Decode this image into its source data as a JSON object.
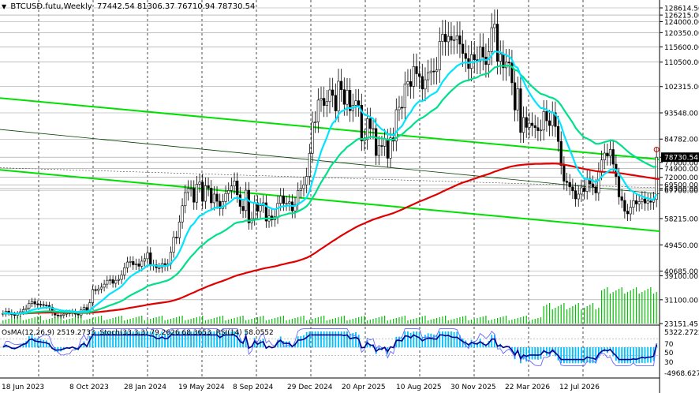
{
  "header": {
    "symbol": "BTCUSD.futu",
    "timeframe": "Weekly",
    "ohlc": "77442.54 81306.37 76710.94 78730.54"
  },
  "indicator_header": {
    "osma": "OsMA(12,26,9) 2519.2733",
    "stoch": "Stoch(33,3,3) 79.2626 68.3653",
    "rsi": "RSI(14) 58.0552"
  },
  "colors": {
    "background": "#ffffff",
    "candle": "#000000",
    "ema_fast": "#00e5ff",
    "ema_mid": "#00e08a",
    "ema_slow": "#e00000",
    "channel": "#00e000",
    "volume": "#00c000",
    "osma": "#00bfff",
    "stoch_main": "#00008b",
    "grid": "#000000"
  },
  "chart_data": {
    "type": "candlestick",
    "price_axis_labels": [
      "128614.50",
      "126215.00",
      "124000.00",
      "120350.00",
      "115600.00",
      "110500.00",
      "102315.00",
      "93548.00",
      "84782.00",
      "78730.54",
      "77000.00",
      "74900.00",
      "72000.00",
      "69500.00",
      "68300.00",
      "67700.00",
      "58215.00",
      "49450.00",
      "40685.00",
      "39100.00",
      "31100.00",
      "23151.45"
    ],
    "price_axis_values": [
      128614.5,
      126215,
      124000,
      120350,
      115600,
      110500,
      102315,
      93548,
      84782,
      78730.54,
      77000,
      74900,
      72000,
      69500,
      68300,
      67700,
      58215,
      49450,
      40685,
      39100,
      31100,
      23151.45
    ],
    "indicator_axis_labels": [
      "5322.2722",
      "70",
      "50",
      "30",
      "-4968.6279"
    ],
    "time_axis_labels": [
      "18 Jun 2023",
      "8 Oct 2023",
      "28 Jan 2024",
      "19 May 2024",
      "8 Sep 2024",
      "29 Dec 2024",
      "20 Apr 2025",
      "10 Aug 2025",
      "30 Nov 2025",
      "22 Mar 2026",
      "12 Jul 2026"
    ],
    "price_range": [
      23151.45,
      128614.5
    ],
    "current_price": 78730.54,
    "close_series": [
      26500,
      27300,
      26800,
      26100,
      25900,
      26300,
      27100,
      27800,
      28300,
      29900,
      30500,
      29700,
      29600,
      29500,
      29300,
      29200,
      28600,
      26800,
      26000,
      25900,
      25900,
      26300,
      26700,
      26500,
      27000,
      26300,
      26000,
      27700,
      28500,
      27200,
      30100,
      34500,
      34200,
      34700,
      35300,
      36300,
      37600,
      37800,
      36600,
      37600,
      37900,
      39400,
      41800,
      43700,
      43900,
      42800,
      43100,
      42300,
      44000,
      44800,
      46800,
      42600,
      42800,
      41800,
      41800,
      43200,
      42400,
      43000,
      47000,
      52000,
      51800,
      57100,
      62500,
      66900,
      68300,
      68300,
      63700,
      69700,
      70400,
      64000,
      69200,
      68400,
      63500,
      66400,
      64000,
      61600,
      63900,
      66600,
      67600,
      69100,
      70800,
      66200,
      62300,
      60900,
      67700,
      56800,
      58200,
      63500,
      60700,
      62600,
      63500,
      57400,
      59100,
      57800,
      58800,
      63300,
      65800,
      63300,
      63300,
      63800,
      60800,
      62900,
      67600,
      68300,
      69500,
      72300,
      80000,
      90400,
      90500,
      97800,
      98400,
      96000,
      97300,
      101200,
      99400,
      94200,
      104100,
      101300,
      96400,
      101100,
      94300,
      96100,
      97600,
      96100,
      84200,
      84600,
      91600,
      88300,
      88300,
      79300,
      82600,
      82400,
      84800,
      78400,
      85200,
      84100,
      94600,
      95400,
      95200,
      103200,
      104000,
      102400,
      109000,
      106600,
      105700,
      101500,
      104600,
      107000,
      107500,
      107300,
      107900,
      117400,
      119800,
      117300,
      119100,
      117800,
      118000,
      119300,
      116500,
      113400,
      111700,
      108400,
      113000,
      111300,
      110900,
      115500,
      112200,
      109700,
      114000,
      122000,
      123200,
      110800,
      113200,
      108600,
      110500,
      110200,
      103600,
      94500,
      101600,
      87000,
      92000,
      88700,
      90100,
      89300,
      88600,
      87600,
      87800,
      94000,
      90900,
      89300,
      93600,
      89000,
      84000,
      76000,
      70700,
      70300,
      68800,
      67500,
      64800,
      66400,
      68500,
      67300,
      71500,
      69800,
      68800,
      66800,
      74000,
      77800,
      80100,
      79100,
      81300,
      76400,
      72300,
      65500,
      64300,
      60700,
      59800,
      62000,
      64200,
      63100,
      63900,
      64800,
      63400,
      64100,
      63700,
      64600,
      78730.54
    ],
    "ema_fast_series": [
      26500,
      26600,
      26635,
      26550,
      26460,
      26440,
      26530,
      26700,
      26900,
      27290,
      27680,
      27920,
      28120,
      28280,
      28410,
      28510,
      28520,
      28310,
      28030,
      27790,
      27580,
      27450,
      27390,
      27300,
      27260,
      27150,
      27010,
      27090,
      27260,
      27240,
      27560,
      28420,
      29150,
      29880,
      30620,
      31430,
      32300,
      33090,
      33640,
      34280,
      34860,
      35620,
      36650,
      37810,
      38820,
      39480,
      40110,
      40540,
      41150,
      41770,
      42660,
      42630,
      42650,
      42480,
      42340,
      42460,
      42420,
      42480,
      43120,
      44360,
      45410,
      47180,
      49310,
      51830,
      53910,
      55700,
      56570,
      57950,
      59180,
      59460,
      60240,
      60810,
      61130,
      61690,
      61960,
      61940,
      62200,
      62730,
      63380,
      64130,
      65010,
      65150,
      64860,
      64400,
      64920,
      64160,
      63590,
      63560,
      63150,
      63000,
      62990,
      62350,
      61960,
      61530,
      61300,
      61610,
      62140,
      62310,
      62450,
      62650,
      62470,
      62500,
      63030,
      63600,
      64300,
      65290,
      67380,
      70750,
      73740,
      77410,
      80660,
      83090,
      85370,
      88100,
      90080,
      91010,
      92980,
      94060,
      94410,
      95250,
      95110,
      95260,
      95640,
      95710,
      94130,
      92910,
      92710,
      92130,
      91630,
      89990,
      88960,
      88020,
      87550,
      86340,
      86300,
      86050,
      87200,
      88270,
      89160,
      90940,
      92610,
      93770,
      95480,
      96620,
      97440,
      97480,
      98040,
      98800,
      99500,
      100040,
      100590,
      102190,
      103900,
      105120,
      106440,
      107420,
      108270,
      109230,
      109770,
      110220,
      110430,
      110200,
      110520,
      110600,
      110650,
      111260,
      111370,
      111150,
      111500,
      112790,
      114050,
      113940,
      113840,
      113220,
      112810,
      112440,
      111350,
      109130,
      108610,
      106050,
      104180,
      102000,
      100320,
      98750,
      97380,
      96140,
      95120,
      95070,
      94540,
      93870,
      93820,
      93020,
      91670,
      89300,
      86180,
      83660,
      81210,
      78840,
      76220,
      74310,
      72870,
      71550,
      71510,
      71270,
      70930,
      70360,
      71140,
      72130,
      73150,
      73750,
      74550,
      74790,
      74500,
      73140,
      71820,
      70230,
      68710,
      67760,
      67160,
      66500,
      66010,
      65700,
      65250,
      64980,
      64700,
      64560,
      66400
    ],
    "ema_mid_series": [
      26500,
      26530,
      26540,
      26520,
      26490,
      26480,
      26510,
      26560,
      26620,
      26750,
      26890,
      26980,
      27060,
      27140,
      27200,
      27250,
      27280,
      27240,
      27170,
      27100,
      27040,
      26990,
      26960,
      26920,
      26900,
      26860,
      26800,
      26800,
      26850,
      26850,
      26950,
      27250,
      27530,
      27820,
      28130,
      28480,
      28870,
      29250,
      29570,
      29930,
      30280,
      30710,
      31280,
      31920,
      32540,
      33050,
      33550,
      33990,
      34510,
      35040,
      35680,
      35980,
      36280,
      36510,
      36730,
      37040,
      37300,
      37580,
      38080,
      38820,
      39510,
      40490,
      41650,
      43000,
      44290,
      45520,
      46460,
      47580,
      48660,
      49340,
      50240,
      51040,
      51620,
      52320,
      52880,
      53290,
      53810,
      54420,
      55070,
      55770,
      56530,
      56890,
      57070,
      57170,
      57560,
      57540,
      57580,
      57840,
      57940,
      58110,
      58290,
      58220,
      58290,
      58280,
      58340,
      58670,
      59130,
      59400,
      59660,
      59950,
      60010,
      60180,
      60620,
      61110,
      61670,
      62360,
      63470,
      65110,
      66670,
      68530,
      70340,
      71880,
      73400,
      75140,
      76590,
      77600,
      79020,
      80230,
      81060,
      82150,
      82790,
      83520,
      84290,
      84890,
      84830,
      84820,
      85230,
      85430,
      85620,
      85230,
      85080,
      84920,
      84920,
      84580,
      84620,
      84590,
      85200,
      85810,
      86350,
      87240,
      88110,
      88830,
      89870,
      90730,
      91480,
      91900,
      92520,
      93260,
      94000,
      94630,
      95270,
      96490,
      97810,
      98860,
      99940,
      100870,
      101740,
      102640,
      103350,
      103870,
      104250,
      104400,
      104830,
      105130,
      105400,
      106010,
      106330,
      106470,
      106920,
      107800,
      108710,
      108960,
      109250,
      109240,
      109300,
      109330,
      108910,
      107920,
      107590,
      106330,
      105400,
      104250,
      103260,
      102310,
      101450,
      100600,
      99870,
      99640,
      99250,
      98780,
      98580,
      98060,
      97280,
      96070,
      94540,
      93130,
      91690,
      90240,
      88620,
      87380,
      86310,
      85320,
      84970,
      84420,
      83870,
      83210,
      83200,
      83440,
      83780,
      84020,
      84330,
      84260,
      83930,
      83180,
      82450,
      81560,
      80680,
      79920,
      79270,
      78610,
      78000,
      77450,
      76900,
      76400,
      75920,
      75470,
      75590
    ],
    "ema_slow_series": [
      26500,
      26510,
      26520,
      26520,
      26510,
      26510,
      26520,
      26540,
      26560,
      26610,
      26670,
      26710,
      26740,
      26770,
      26800,
      26820,
      26840,
      26840,
      26820,
      26800,
      26780,
      26760,
      26750,
      26740,
      26740,
      26720,
      26700,
      26710,
      26720,
      26730,
      26760,
      26840,
      26930,
      27010,
      27110,
      27210,
      27330,
      27440,
      27540,
      27650,
      27760,
      27890,
      28060,
      28240,
      28430,
      28590,
      28750,
      28900,
      29070,
      29250,
      29440,
      29590,
      29740,
      29870,
      30000,
      30150,
      30280,
      30420,
      30610,
      30870,
      31140,
      31470,
      31850,
      32280,
      32720,
      33160,
      33550,
      34000,
      34450,
      34830,
      35260,
      35670,
      36010,
      36400,
      36750,
      37070,
      37410,
      37770,
      38150,
      38540,
      38950,
      39270,
      39520,
      39750,
      40090,
      40310,
      40540,
      40810,
      41040,
      41280,
      41530,
      41700,
      41900,
      42070,
      42250,
      42490,
      42760,
      42990,
      43220,
      43460,
      43640,
      43850,
      44140,
      44440,
      44760,
      45120,
      45580,
      46170,
      46770,
      47430,
      48100,
      48730,
      49360,
      50030,
      50670,
      51260,
      51910,
      52530,
      53090,
      53680,
      54220,
      54760,
      55310,
      55830,
      56240,
      56640,
      57080,
      57490,
      57890,
      58200,
      58530,
      58850,
      59180,
      59440,
      59750,
      60050,
      60450,
      60850,
      61260,
      61710,
      62160,
      62590,
      63050,
      63490,
      63910,
      64290,
      64680,
      65080,
      65490,
      65890,
      66280,
      66750,
      67230,
      67680,
      68140,
      68580,
      69010,
      69450,
      69860,
      70230,
      70570,
      70880,
      71220,
      71540,
      71860,
      72210,
      72530,
      72820,
      73130,
      73510,
      73900,
      74230,
      74570,
      74860,
      75150,
      75440,
      75680,
      75830,
      76020,
      76120,
      76230,
      76310,
      76370,
      76420,
      76480,
      76480,
      76490,
      76550,
      76580,
      76580,
      76610,
      76590,
      76530,
      76410,
      76250,
      76080,
      75880,
      75680,
      75440,
      75220,
      75010,
      74800,
      74640,
      74460,
      74280,
      74080,
      73970,
      73890,
      73820,
      73740,
      73680,
      73620,
      73540,
      73430,
      73310,
      73170,
      73020,
      72860,
      72710,
      72560,
      72410,
      72260,
      72110,
      71960,
      71810,
      71650,
      71500,
      71460
    ],
    "volume_note": "volume histogram",
    "osma_note": "OsMA histogram with Stochastic and RSI lines"
  }
}
